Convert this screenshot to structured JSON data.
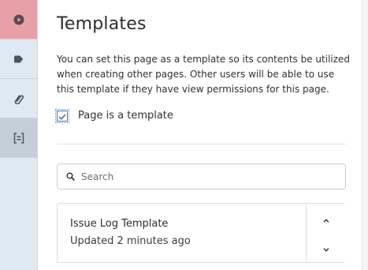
{
  "sidebar": {
    "items": [
      {
        "icon": "play-icon",
        "active": true,
        "color": "#e8a0a8"
      },
      {
        "icon": "tag-icon"
      },
      {
        "icon": "paperclip-icon"
      },
      {
        "icon": "template-icon",
        "selected": true
      }
    ]
  },
  "main": {
    "title": "Templates",
    "description": "You can set this page as a template so its contents be utilized when creating other pages. Other users will be able to use this template if they have view permissions for this page.",
    "checkbox": {
      "label": "Page is a template",
      "checked": true
    },
    "search": {
      "placeholder": "Search",
      "value": ""
    },
    "templates": [
      {
        "name": "Issue Log Template",
        "updated": "Updated 2 minutes ago"
      }
    ]
  },
  "colors": {
    "accent": "#3b79b5",
    "rail_bg": "#dfe9f2",
    "rail_active": "#e8a0a8",
    "rail_selected": "#c4ced8"
  }
}
